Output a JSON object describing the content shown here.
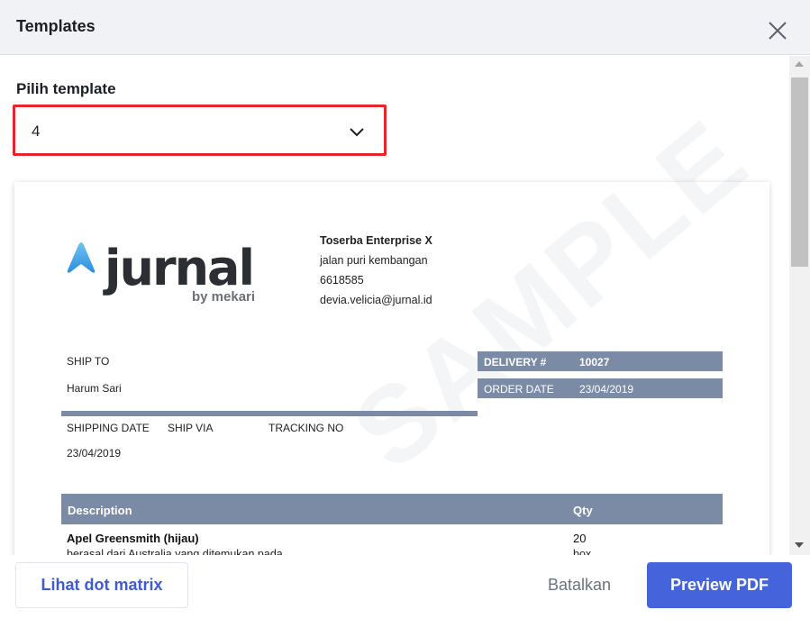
{
  "modal": {
    "title": "Templates",
    "close_icon": "close-icon"
  },
  "template_select": {
    "label": "Pilih template",
    "value": "4",
    "chevron_icon": "chevron-down-icon",
    "highlight_color": "#e8242c"
  },
  "preview": {
    "logo_text": "jurnal",
    "logo_sub": "by mekari",
    "company": {
      "name": "Toserba Enterprise X",
      "address": "jalan puri kembangan",
      "phone": "6618585",
      "email": "devia.velicia@jurnal.id"
    },
    "ship_to_label": "SHIP TO",
    "ship_to_value": "Harum Sari",
    "shipping_date_label": "SHIPPING DATE",
    "ship_via_label": "SHIP VIA",
    "tracking_no_label": "TRACKING NO",
    "shipping_date_value": "23/04/2019",
    "delivery_label": "DELIVERY #",
    "delivery_value": "10027",
    "order_date_label": "ORDER DATE",
    "order_date_value": "23/04/2019",
    "table": {
      "col_description": "Description",
      "col_qty": "Qty",
      "rows": [
        {
          "description": "Apel Greensmith (hijau)",
          "qty": "20"
        },
        {
          "description": "berasal dari Australia yang ditemukan pada",
          "qty": "box"
        }
      ]
    },
    "watermark": "SAMPLE",
    "header_color": "#7b8ba5"
  },
  "footer": {
    "dot_matrix_label": "Lihat dot matrix",
    "cancel_label": "Batalkan",
    "preview_pdf_label": "Preview PDF",
    "primary_color": "#4564dc"
  }
}
